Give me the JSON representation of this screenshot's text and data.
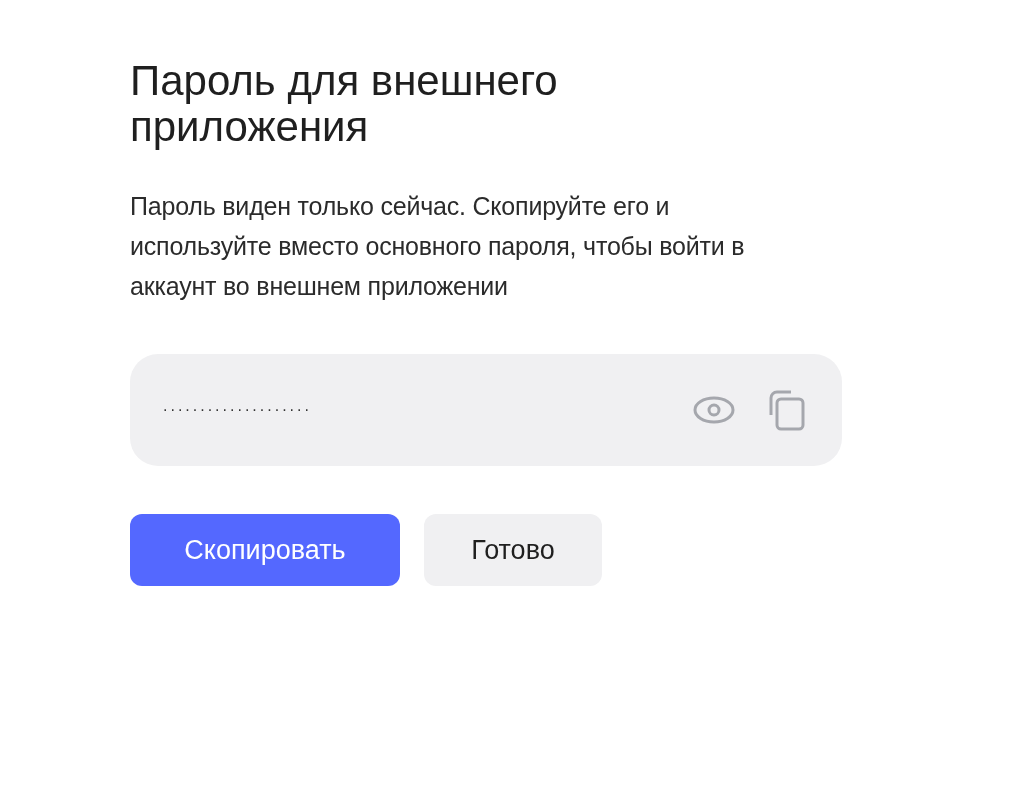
{
  "title": "Пароль для внешнего приложения",
  "description": "Пароль виден только сейчас. Скопируйте его и используйте вместо основного пароля, чтобы войти в аккаунт во внешнем приложении",
  "password_field": {
    "value": "...................."
  },
  "buttons": [
    {
      "label": "Скопировать",
      "kind": "primary"
    },
    {
      "label": "Готово",
      "kind": "secondary"
    }
  ]
}
